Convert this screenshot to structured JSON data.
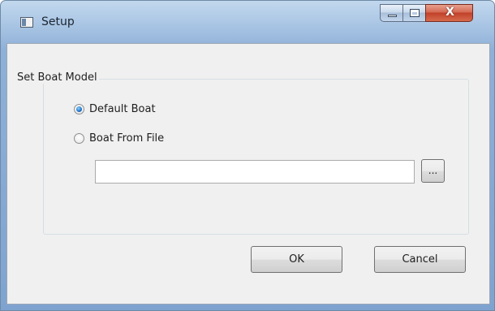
{
  "window": {
    "title": "Setup",
    "close_glyph": "X",
    "icons": [
      "app-icon",
      "minimize-icon",
      "maximize-icon",
      "close-icon"
    ]
  },
  "group": {
    "title": "Set Boat Model",
    "options": [
      {
        "label": "Default Boat",
        "checked": true
      },
      {
        "label": "Boat From File",
        "checked": false
      }
    ],
    "file_path_value": "",
    "browse_label": "..."
  },
  "buttons": {
    "ok_label": "OK",
    "cancel_label": "Cancel"
  }
}
